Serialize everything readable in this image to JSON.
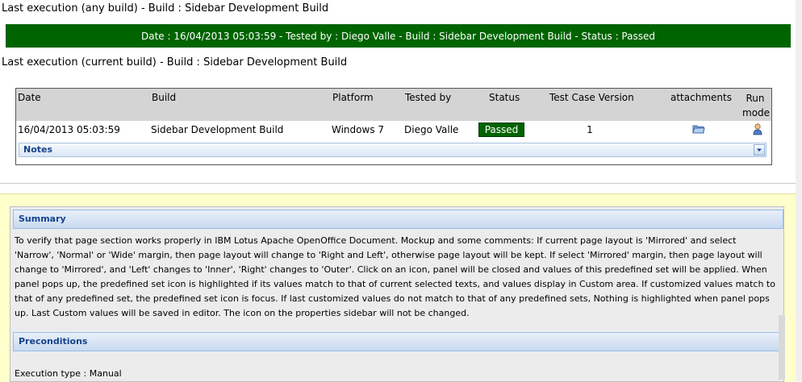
{
  "last_any": {
    "heading": "Last execution (any build) - Build : Sidebar Development Build",
    "status_line": "Date : 16/04/2013 05:03:59 - Tested by : Diego Valle - Build : Sidebar Development Build - Status : Passed"
  },
  "last_current": {
    "heading": "Last execution (current build) - Build : Sidebar Development Build"
  },
  "table": {
    "headers": {
      "date": "Date",
      "build": "Build",
      "platform": "Platform",
      "tested_by": "Tested by",
      "status": "Status",
      "tc_version": "Test Case Version",
      "attachments": "attachments",
      "run_mode_1": "Run",
      "run_mode_2": "mode"
    },
    "row": {
      "date": "16/04/2013 05:03:59",
      "build": "Sidebar Development Build",
      "platform": "Windows 7",
      "tested_by": "Diego Valle",
      "status": "Passed",
      "tc_version": "1"
    },
    "notes_label": "Notes"
  },
  "summary": {
    "title": "Summary",
    "lines": [
      "To verify that page section works properly in IBM Lotus Apache OpenOffice Document. Mockup and some comments: If current page layout is 'Mirrored' and select",
      "'Narrow', 'Normal' or 'Wide' margin, then page layout will change to 'Right and Left', otherwise page layout will be kept. If select 'Mirrored' margin, then page layout will",
      "change to 'Mirrored', and 'Left' changes to 'Inner', 'Right' changes to 'Outer'. Click on an icon, panel will be closed and values of this predefined set will be applied. When",
      "panel pops up, the predefined set icon is highlighted if its values match to that of current selected texts, and values display in Custom area. If customized values match to",
      "that of any predefined set, the predefined set icon is focus. If last customized values do not match to that of any predefined sets, Nothing is highlighted when panel pops",
      "up. Last Custom values will be saved in editor. The icon on the properties sidebar will not be changed."
    ]
  },
  "preconditions": {
    "title": "Preconditions"
  },
  "execution_type": "Execution type : Manual",
  "colors": {
    "passed_green": "#006400",
    "highlight_yellow": "#ffffcc",
    "header_blue": "#15428b"
  },
  "icons": {
    "attachments": "folder-icon",
    "run_mode": "user-icon",
    "notes_toggle": "chevron-down-icon"
  }
}
